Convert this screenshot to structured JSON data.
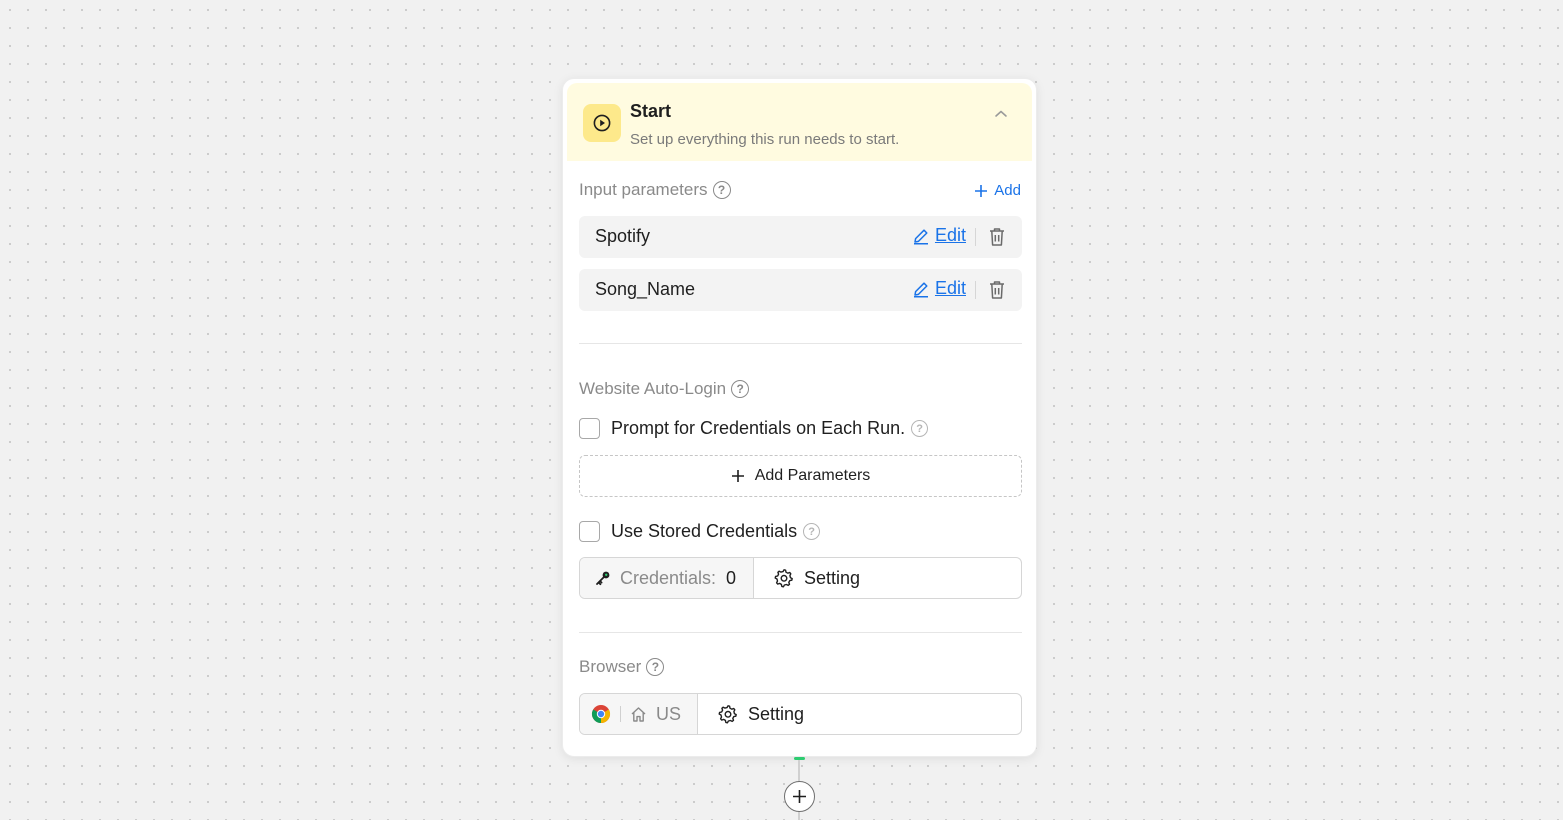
{
  "start_node": {
    "title": "Start",
    "subtitle": "Set up everything this run needs to start.",
    "icon": "play-circle-icon",
    "header_color": "#fffbe0",
    "icon_bg_color": "#fde98b"
  },
  "input_parameters": {
    "label": "Input parameters",
    "help": "?",
    "add_label": "Add",
    "edit_label": "Edit",
    "items": [
      {
        "name": "Spotify"
      },
      {
        "name": "Song_Name"
      }
    ]
  },
  "auto_login": {
    "label": "Website Auto-Login",
    "help": "?",
    "prompt_checkbox_label": "Prompt for Credentials on Each Run.",
    "prompt_checked": false,
    "add_parameters_label": "Add Parameters",
    "stored_checkbox_label": "Use Stored Credentials",
    "stored_checked": false,
    "credentials_label": "Credentials:",
    "credentials_count": "0",
    "setting_label": "Setting"
  },
  "browser": {
    "label": "Browser",
    "help": "?",
    "browser_icon": "chrome-icon",
    "region": "US",
    "setting_label": "Setting"
  },
  "colors": {
    "accent": "#1a73e8",
    "connector_active": "#2ecc71"
  }
}
